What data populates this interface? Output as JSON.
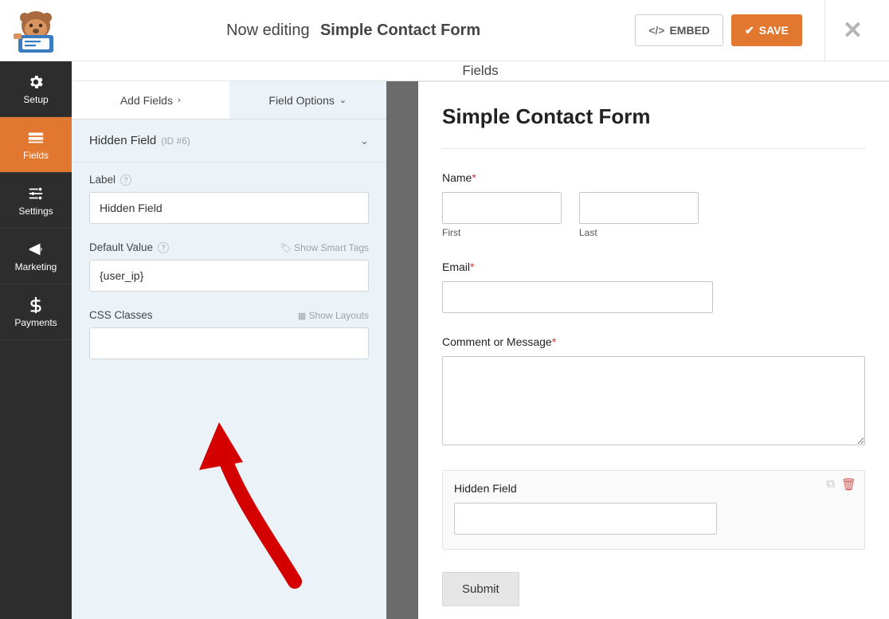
{
  "header": {
    "now_editing": "Now editing",
    "form_name": "Simple Contact Form",
    "embed": "EMBED",
    "save": "SAVE"
  },
  "sidenav": {
    "setup": "Setup",
    "fields": "Fields",
    "settings": "Settings",
    "marketing": "Marketing",
    "payments": "Payments"
  },
  "tabbar": {
    "title": "Fields"
  },
  "subtabs": {
    "add": "Add Fields",
    "options": "Field Options"
  },
  "field": {
    "title": "Hidden Field",
    "id": "(ID #6)",
    "label_text": "Label",
    "label_value": "Hidden Field",
    "default_text": "Default Value",
    "default_value": "{user_ip}",
    "smart": "Show Smart Tags",
    "css_text": "CSS Classes",
    "css_value": "",
    "layouts": "Show Layouts"
  },
  "preview": {
    "title": "Simple Contact Form",
    "name": "Name",
    "first": "First",
    "last": "Last",
    "email": "Email",
    "comment": "Comment or Message",
    "hidden": "Hidden Field",
    "submit": "Submit"
  }
}
